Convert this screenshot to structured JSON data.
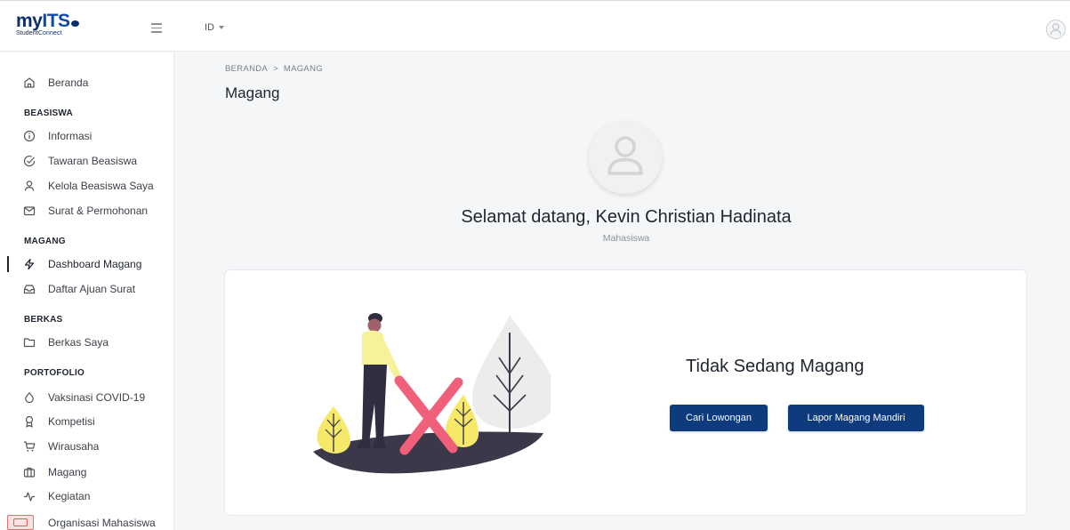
{
  "app": {
    "logo_main_prefix": "my",
    "logo_main_its": "ITS",
    "logo_sub": "StudentConnect"
  },
  "topbar": {
    "language": "ID"
  },
  "sidebar": {
    "items": [
      {
        "label": "Beranda",
        "icon": "home-icon"
      },
      {
        "section": "BEASISWA"
      },
      {
        "label": "Informasi",
        "icon": "info-icon"
      },
      {
        "label": "Tawaran Beasiswa",
        "icon": "check-circle-icon"
      },
      {
        "label": "Kelola Beasiswa Saya",
        "icon": "user-icon"
      },
      {
        "label": "Surat & Permohonan",
        "icon": "mail-icon"
      },
      {
        "section": "MAGANG"
      },
      {
        "label": "Dashboard Magang",
        "icon": "zap-icon",
        "active": true
      },
      {
        "label": "Daftar Ajuan Surat",
        "icon": "inbox-icon"
      },
      {
        "section": "BERKAS"
      },
      {
        "label": "Berkas Saya",
        "icon": "folder-icon"
      },
      {
        "section": "PORTOFOLIO"
      },
      {
        "label": "Vaksinasi COVID-19",
        "icon": "droplet-icon"
      },
      {
        "label": "Kompetisi",
        "icon": "award-icon"
      },
      {
        "label": "Wirausaha",
        "icon": "cart-icon"
      },
      {
        "label": "Magang",
        "icon": "briefcase-icon"
      },
      {
        "label": "Kegiatan",
        "icon": "activity-icon"
      },
      {
        "label": "Organisasi Mahasiswa",
        "icon": "users-icon"
      }
    ]
  },
  "breadcrumb": {
    "home": "BERANDA",
    "separator": ">",
    "current": "MAGANG"
  },
  "page": {
    "title": "Magang",
    "welcome": "Selamat datang, Kevin Christian Hadinata",
    "role": "Mahasiswa"
  },
  "status_card": {
    "title": "Tidak Sedang Magang",
    "btn_cari": "Cari Lowongan",
    "btn_lapor": "Lapor Magang Mandiri"
  },
  "colors": {
    "brand": "#0d3b7e",
    "accent_red": "#f0607a",
    "plant_yellow": "#f6e96a"
  }
}
